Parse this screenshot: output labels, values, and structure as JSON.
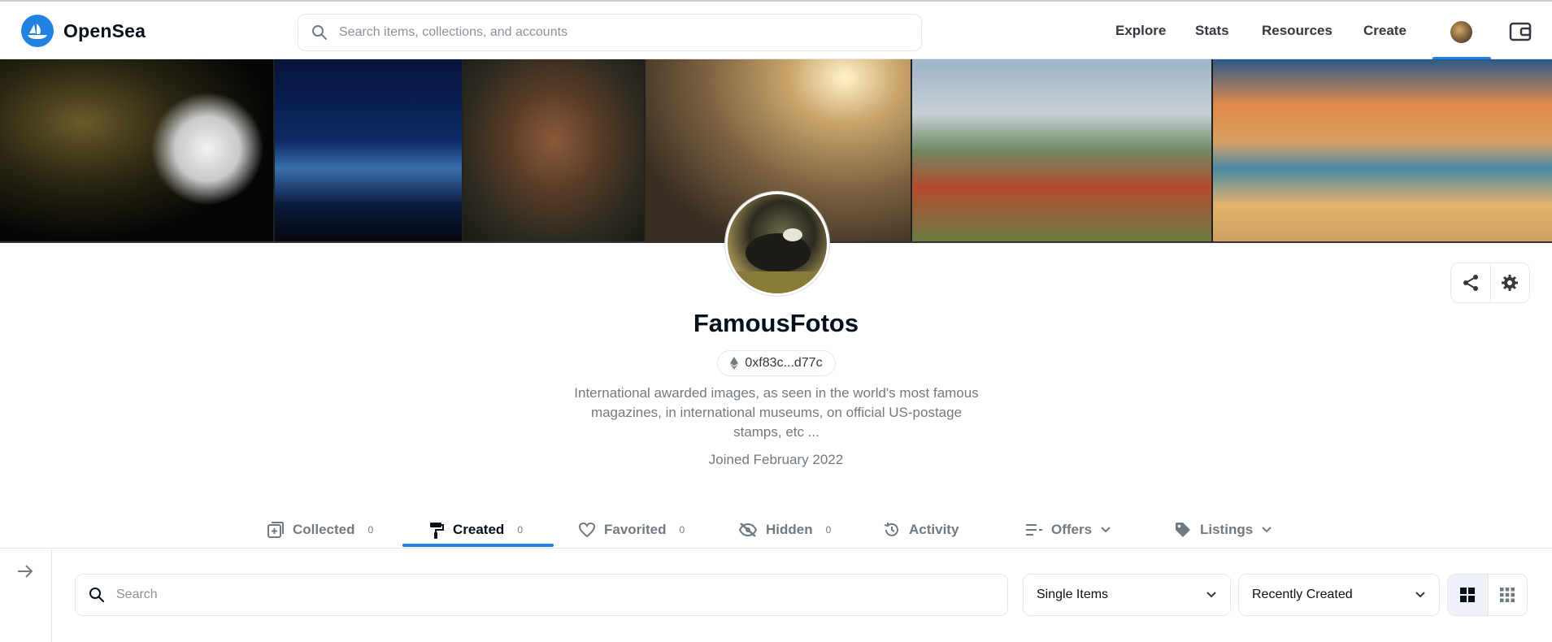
{
  "header": {
    "logo_text": "OpenSea",
    "search_placeholder": "Search items, collections, and accounts",
    "nav": [
      {
        "label": "Explore"
      },
      {
        "label": "Stats"
      },
      {
        "label": "Resources"
      },
      {
        "label": "Create"
      }
    ],
    "icons": [
      "opensea-logo-icon",
      "search-icon",
      "profile-avatar-icon",
      "wallet-icon"
    ]
  },
  "banner": {
    "images": [
      "banner-image-smoker",
      "banner-image-mountains",
      "banner-image-portrait",
      "banner-image-clouds",
      "banner-image-poppy-field",
      "banner-image-beach"
    ]
  },
  "profile": {
    "name": "FamousFotos",
    "address": "0xf83c...d77c",
    "bio": "International awarded images, as seen in the world's most famous magazines, in international museums, on official US-postage stamps, etc ...",
    "joined": "Joined February 2022"
  },
  "actions": [
    "share-icon",
    "settings-gear-icon"
  ],
  "tabs": [
    {
      "label": "Collected",
      "count": "0",
      "icon": "collected-icon"
    },
    {
      "label": "Created",
      "count": "0",
      "icon": "paint-roller-icon",
      "active": true
    },
    {
      "label": "Favorited",
      "count": "0",
      "icon": "heart-icon"
    },
    {
      "label": "Hidden",
      "count": "0",
      "icon": "eye-off-icon"
    },
    {
      "label": "Activity",
      "icon": "history-icon"
    },
    {
      "label": "Offers",
      "icon": "offers-list-icon"
    },
    {
      "label": "Listings",
      "icon": "tag-icon"
    }
  ],
  "filters": {
    "search_placeholder": "Search",
    "item_type": "Single Items",
    "sort": "Recently Created",
    "view_modes": [
      "large-grid-icon",
      "small-grid-icon"
    ]
  },
  "colors": {
    "accent": "#2081e2",
    "text_primary": "#04111d",
    "text_secondary": "#707a83",
    "border": "#e5e8eb"
  }
}
